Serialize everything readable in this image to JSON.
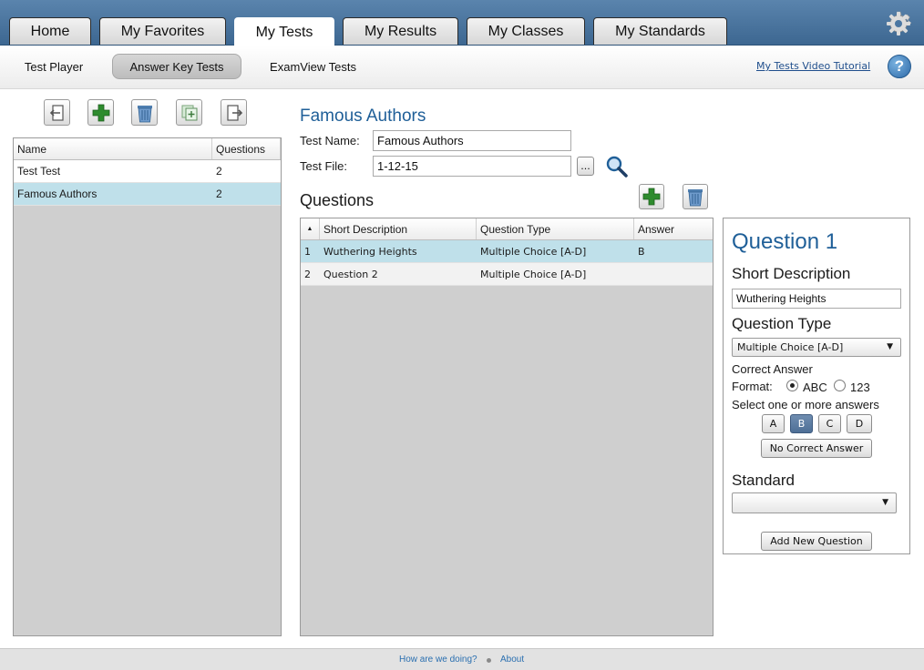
{
  "nav": {
    "tabs": [
      {
        "label": "Home"
      },
      {
        "label": "My Favorites"
      },
      {
        "label": "My Tests"
      },
      {
        "label": "My Results"
      },
      {
        "label": "My Classes"
      },
      {
        "label": "My Standards"
      }
    ],
    "active_tab": "My Tests",
    "settings_icon": "gear-icon"
  },
  "subnav": {
    "items": [
      {
        "label": "Test Player"
      },
      {
        "label": "Answer Key Tests"
      },
      {
        "label": "ExamView Tests"
      }
    ],
    "active_item": "Answer Key Tests",
    "tutorial_link": "My Tests Video Tutorial",
    "help_label": "?"
  },
  "tests_panel": {
    "toolbar_icons": [
      "import-icon",
      "add-icon",
      "trash-icon",
      "duplicate-icon",
      "export-icon"
    ],
    "columns": [
      "Name",
      "Questions"
    ],
    "rows": [
      {
        "name": "Test Test",
        "questions": "2"
      },
      {
        "name": "Famous Authors",
        "questions": "2"
      }
    ],
    "selected_row": "Famous Authors"
  },
  "test_editor": {
    "title": "Famous Authors",
    "test_name_label": "Test Name:",
    "test_name_value": "Famous Authors",
    "test_file_label": "Test File:",
    "test_file_value": "1-12-15",
    "browse_label": "...",
    "questions_heading": "Questions",
    "columns": [
      "Short Description",
      "Question Type",
      "Answer"
    ],
    "rows": [
      {
        "num": "1",
        "description": "Wuthering Heights",
        "type": "Multiple Choice [A-D]",
        "answer": "B"
      },
      {
        "num": "2",
        "description": "Question 2",
        "type": "Multiple Choice [A-D]",
        "answer": ""
      }
    ],
    "selected_row": "1"
  },
  "question_detail": {
    "title": "Question 1",
    "short_desc_label": "Short Description",
    "short_desc_value": "Wuthering Heights",
    "type_label": "Question Type",
    "type_value": "Multiple Choice [A-D]",
    "correct_answer_label": "Correct Answer",
    "format_label": "Format:",
    "format_abc": "ABC",
    "format_123": "123",
    "format_selected": "ABC",
    "select_label": "Select one or more answers",
    "answers": [
      "A",
      "B",
      "C",
      "D"
    ],
    "selected_answer": "B",
    "no_correct_label": "No Correct Answer",
    "standard_label": "Standard",
    "standard_value": "",
    "add_question_label": "Add New Question"
  },
  "footer": {
    "feedback_link": "How are we doing?",
    "about_link": "About"
  },
  "colors": {
    "header_blue": "#3d6791",
    "title_blue": "#1f5f98",
    "selected_row": "#bfe0ea",
    "add_green": "#2e8b2e"
  }
}
